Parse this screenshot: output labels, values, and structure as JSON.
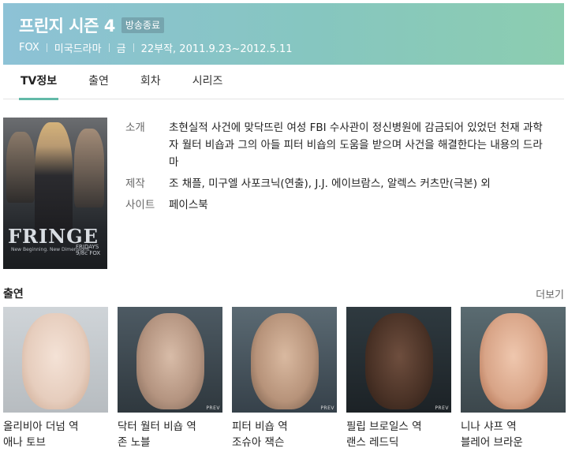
{
  "header": {
    "title": "프린지 시즌 4",
    "status": "방송종료",
    "meta": [
      "FOX",
      "미국드라마",
      "금",
      "22부작, 2011.9.23~2012.5.11"
    ]
  },
  "tabs": [
    {
      "label": "TV정보",
      "active": true
    },
    {
      "label": "출연",
      "active": false
    },
    {
      "label": "회차",
      "active": false
    },
    {
      "label": "시리즈",
      "active": false
    }
  ],
  "poster": {
    "title": "FRINGE",
    "tagline": "New Beginning. New Dimensions.",
    "badge_line1": "FRIDAYS",
    "badge_line2": "9/8c FOX"
  },
  "info": {
    "intro_label": "소개",
    "intro_text": "초현실적 사건에 맞닥뜨린 여성 FBI 수사관이 정신병원에 감금되어 있었던 천재 과학자 월터 비숍과 그의 아들 피터 비숍의 도움을 받으며 사건을 해결한다는 내용의 드라마",
    "production_label": "제작",
    "production_text": "조 채플, 미구엘 사포크닉(연출), J.J. 에이브람스, 알렉스 커츠만(극본) 외",
    "site_label": "사이트",
    "site_link": "페이스북"
  },
  "cast": {
    "title": "출연",
    "more": "더보기",
    "prev_label": "PREV",
    "members": [
      {
        "role": "올리비아 더넘 역",
        "actor": "애나 토브"
      },
      {
        "role": "닥터 월터 비숍 역",
        "actor": "존 노블"
      },
      {
        "role": "피터 비숍 역",
        "actor": "조슈아 잭슨"
      },
      {
        "role": "필립 브로일스 역",
        "actor": "랜스 레드딕"
      },
      {
        "role": "니나 샤프 역",
        "actor": "블레어 브라운"
      }
    ]
  }
}
